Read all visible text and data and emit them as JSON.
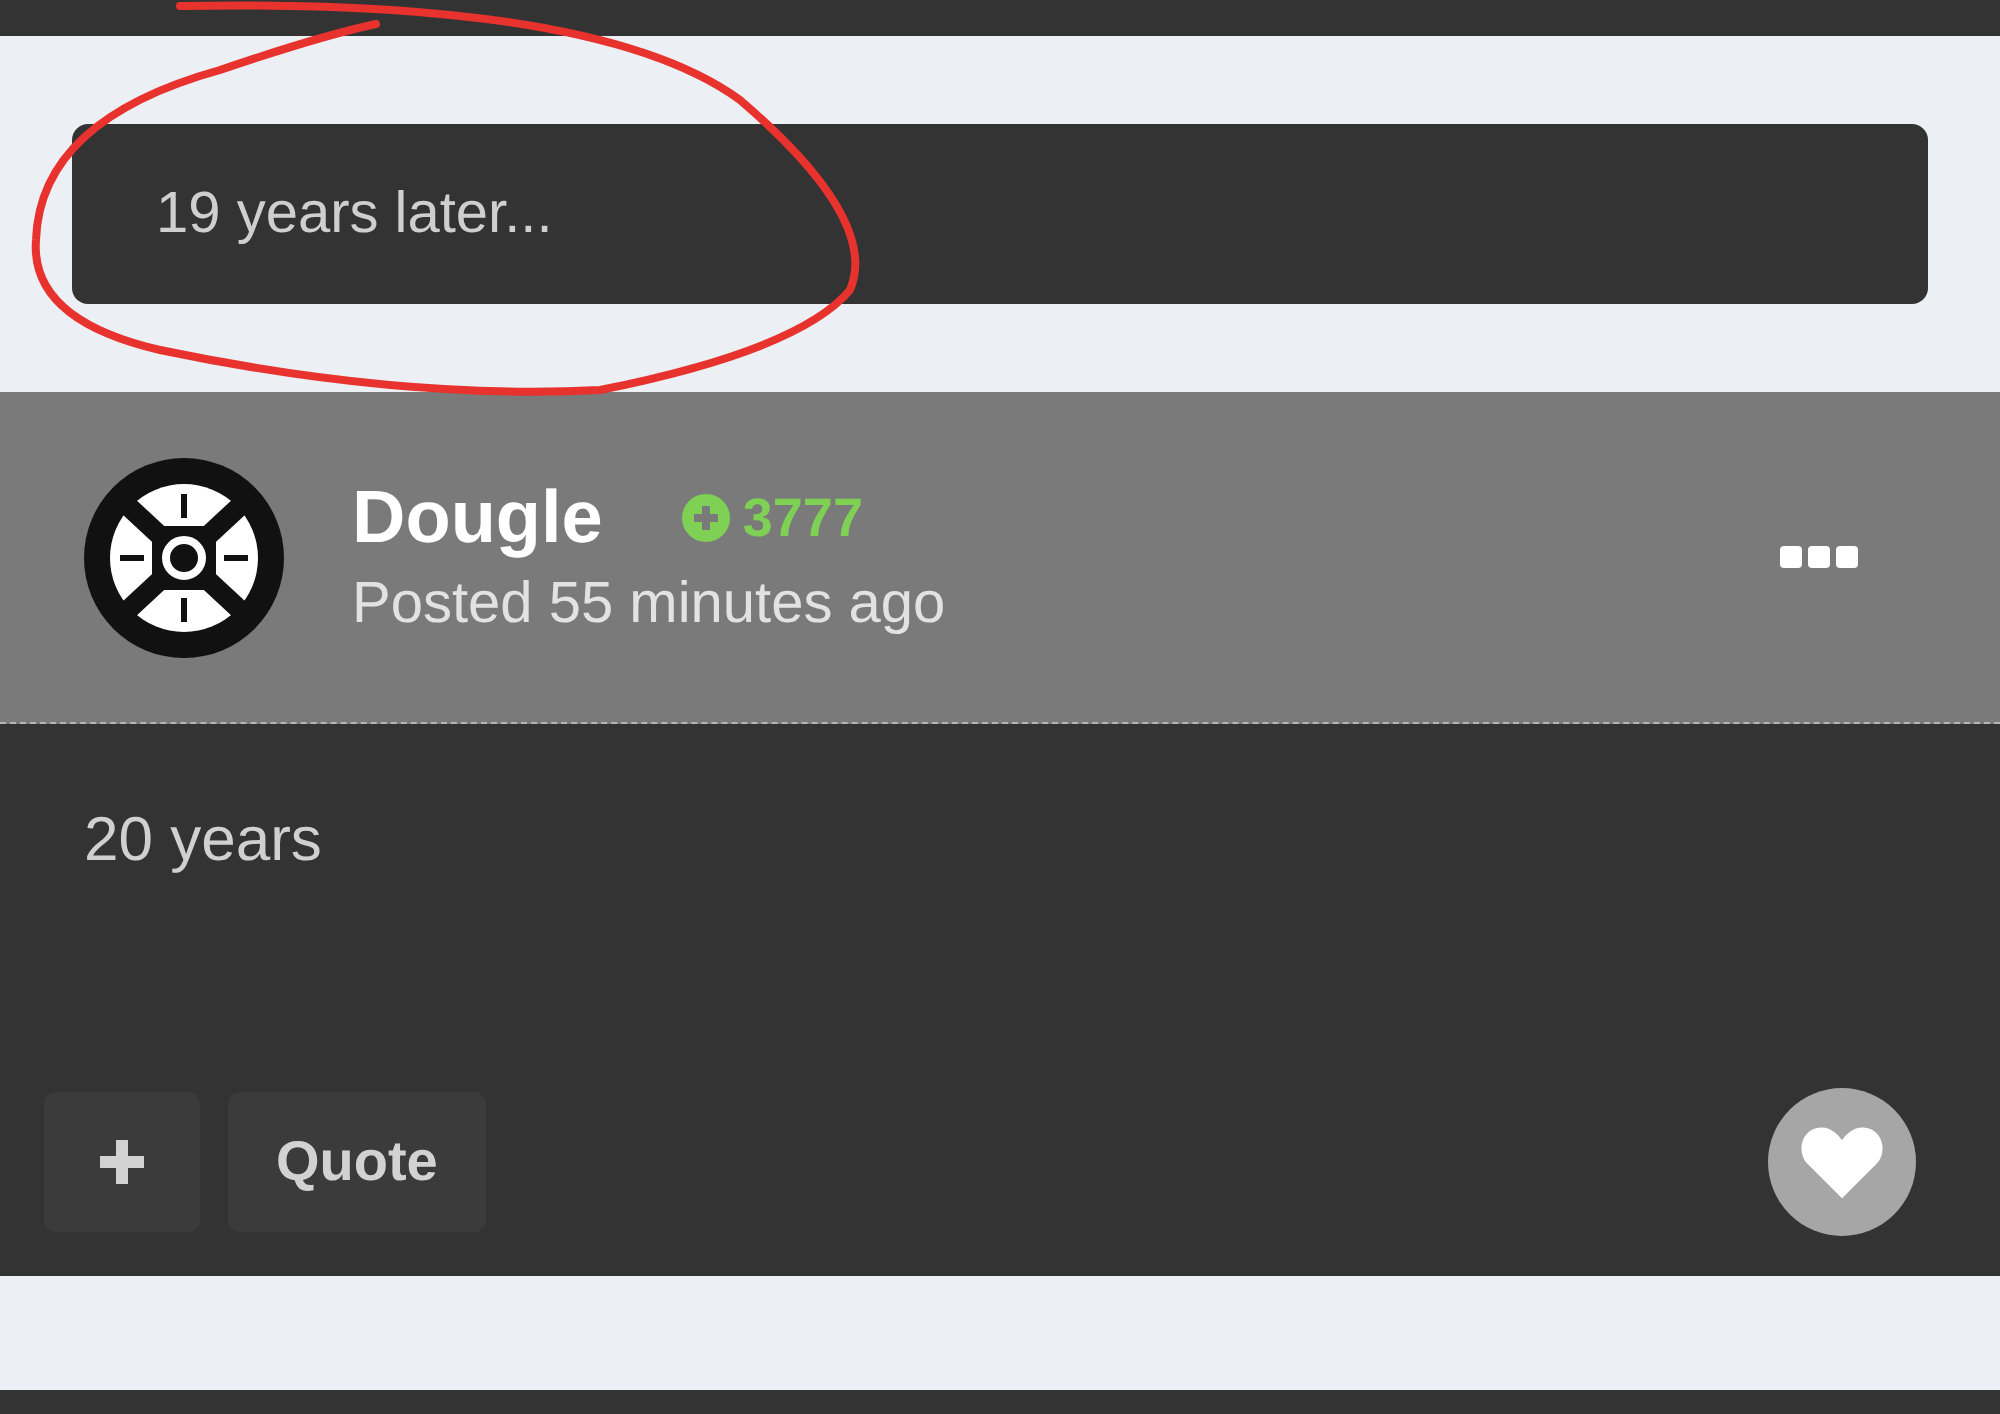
{
  "event": {
    "text": "19 years later..."
  },
  "annotation": {
    "kind": "circle"
  },
  "post": {
    "author": "Dougle",
    "reputation": "3777",
    "posted": "Posted 55 minutes ago",
    "body": "20 years",
    "liked": false,
    "buttons": [
      {
        "kind": "plus"
      },
      {
        "kind": "text",
        "label": "Quote"
      }
    ]
  }
}
